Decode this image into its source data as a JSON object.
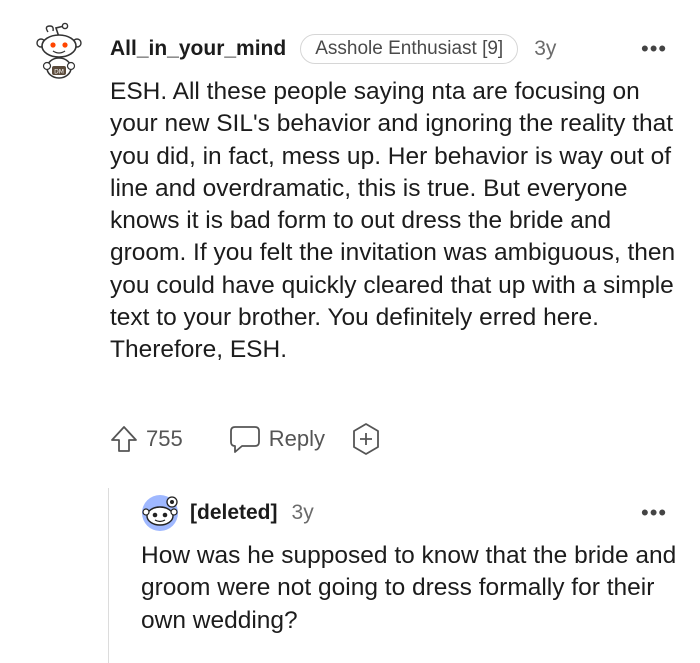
{
  "comment": {
    "avatar_icon": "reddit-snoo-avatar-icon",
    "username": "All_in_your_mind",
    "flair": "Asshole Enthusiast [9]",
    "age": "3y",
    "more_icon": "•••",
    "body": "ESH. All these people saying nta are focusing on your new SIL's behavior and ignoring the reality that you did, in fact, mess up. Her behavior is way out of line and overdramatic, this is true. But everyone knows it is bad form to out dress the bride and groom. If you felt the invitation was ambiguous, then you could have quickly cleared that up with a simple text to your brother. You definitely erred here. Therefore, ESH.",
    "score": "755",
    "reply_label": "Reply",
    "upvote_icon": "upvote-arrow-icon",
    "reply_icon": "speech-bubble-icon",
    "award_icon": "add-award-icon"
  },
  "reply": {
    "avatar_icon": "reddit-snoo-avatar-icon",
    "username": "[deleted]",
    "age": "3y",
    "more_icon": "•••",
    "body": "How was he supposed to know that the bride and groom were not going to dress formally for their own wedding?"
  },
  "colors": {
    "text": "#1c1c1c",
    "meta": "#6b6b6b",
    "thread_line": "#dcdcdc",
    "avatar2_bg": "#9fb8ff"
  }
}
